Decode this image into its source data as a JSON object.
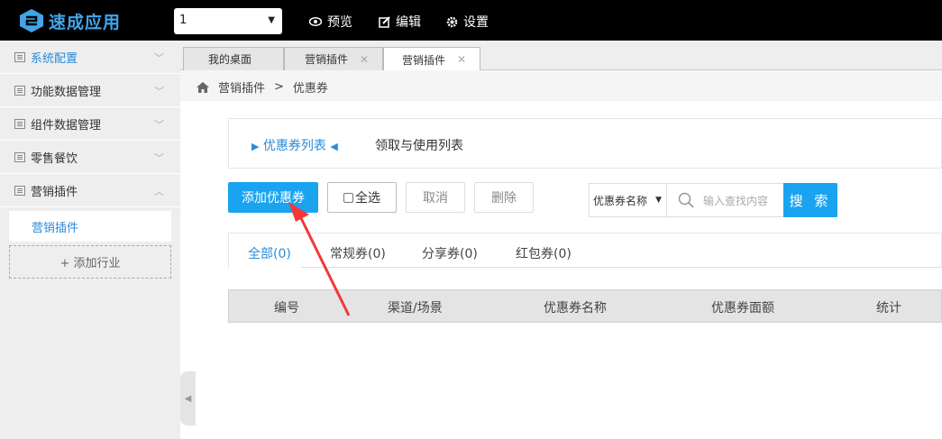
{
  "app": {
    "logo_text": "速成应用",
    "accent": "#41a5e8"
  },
  "topbar": {
    "select_value": "1",
    "nav": [
      {
        "label": "预览",
        "icon": "eye-icon"
      },
      {
        "label": "编辑",
        "icon": "edit-icon"
      },
      {
        "label": "设置",
        "icon": "gear-icon"
      }
    ]
  },
  "sidebar": {
    "items": [
      {
        "label": "系统配置",
        "active": true
      },
      {
        "label": "功能数据管理"
      },
      {
        "label": "组件数据管理"
      },
      {
        "label": "零售餐饮"
      },
      {
        "label": "营销插件",
        "expanded": true
      }
    ],
    "sub_items": [
      {
        "label": "营销插件"
      }
    ],
    "add_industry": "+ 添加行业"
  },
  "tabs": [
    {
      "label": "我的桌面"
    },
    {
      "label": "营销插件"
    },
    {
      "label": "营销插件",
      "active": true
    }
  ],
  "breadcrumb": {
    "parent": "营销插件",
    "sep": ">",
    "current": "优惠券"
  },
  "coupon_tabs": [
    {
      "label": "优惠券列表",
      "active": true
    },
    {
      "label": "领取与使用列表"
    }
  ],
  "actions": {
    "add": "添加优惠券",
    "select_all": "全选",
    "cancel": "取消",
    "delete": "删除"
  },
  "search": {
    "type_value": "优惠券名称",
    "placeholder": "输入查找内容",
    "button": "搜 索"
  },
  "filters": [
    {
      "label": "全部(0)",
      "active": true
    },
    {
      "label": "常规券(0)"
    },
    {
      "label": "分享券(0)"
    },
    {
      "label": "红包券(0)"
    }
  ],
  "table": {
    "columns": [
      "编号",
      "渠道/场景",
      "优惠券名称",
      "优惠券面额",
      "统计"
    ]
  }
}
